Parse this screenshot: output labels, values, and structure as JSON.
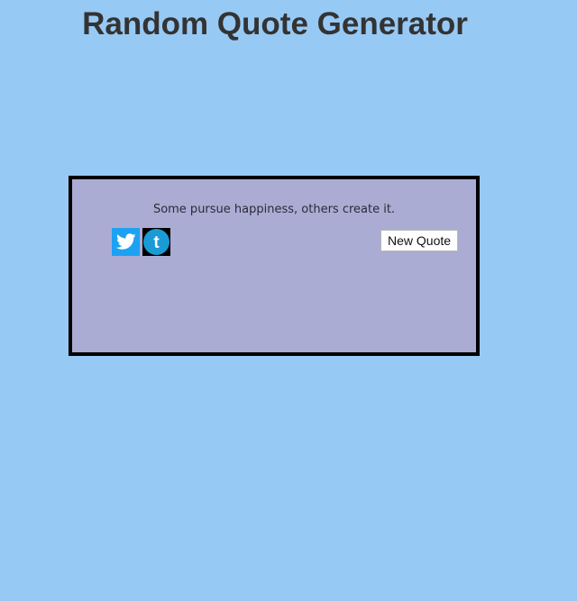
{
  "header": {
    "title": "Random Quote Generator"
  },
  "quote_box": {
    "quote": "Some pursue happiness, others create it.",
    "new_quote_label": "New Quote",
    "share": [
      {
        "icon": "twitter-icon",
        "color": "#1da1f2"
      },
      {
        "icon": "tumblr-icon",
        "color": "#1b9bd6"
      }
    ]
  },
  "colors": {
    "page_background": "#97c9f5",
    "box_background": "#abacd3",
    "box_border": "#000000",
    "title": "#333333"
  }
}
